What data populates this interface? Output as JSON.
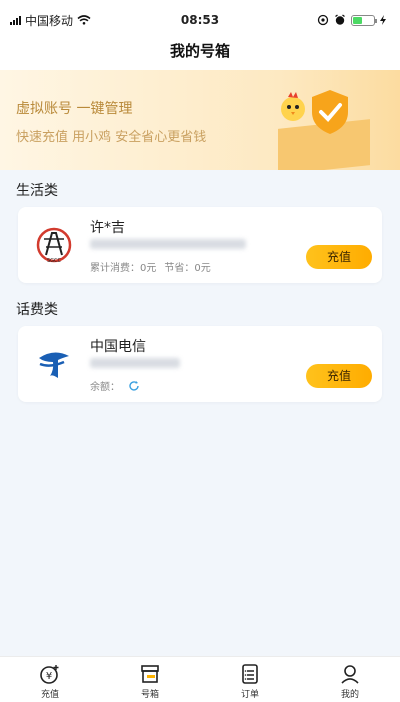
{
  "status_bar": {
    "carrier": "中国移动",
    "time": "08:53"
  },
  "nav": {
    "title": "我的号箱"
  },
  "banner": {
    "title": "虚拟账号 一键管理",
    "subtitle": "快速充值 用小鸡 安全省心更省钱"
  },
  "sections": {
    "life": {
      "title": "生活类",
      "account": {
        "name": "许*吉",
        "meta_spent_label": "累计消费：0元",
        "meta_saved_label": "节省：0元",
        "recharge": "充值",
        "logo_icon": "power-grid-logo"
      }
    },
    "phone": {
      "title": "话费类",
      "account": {
        "name": "中国电信",
        "balance_label": "余额：",
        "recharge": "充值",
        "logo_icon": "china-telecom-logo"
      }
    }
  },
  "tabs": [
    {
      "label": "充值",
      "icon": "recharge-icon"
    },
    {
      "label": "号箱",
      "icon": "box-icon"
    },
    {
      "label": "订单",
      "icon": "order-icon"
    },
    {
      "label": "我的",
      "icon": "profile-icon"
    }
  ],
  "colors": {
    "accent": "#ffb400",
    "background": "#f2f6fb",
    "telecom_blue": "#1a5fb4"
  }
}
